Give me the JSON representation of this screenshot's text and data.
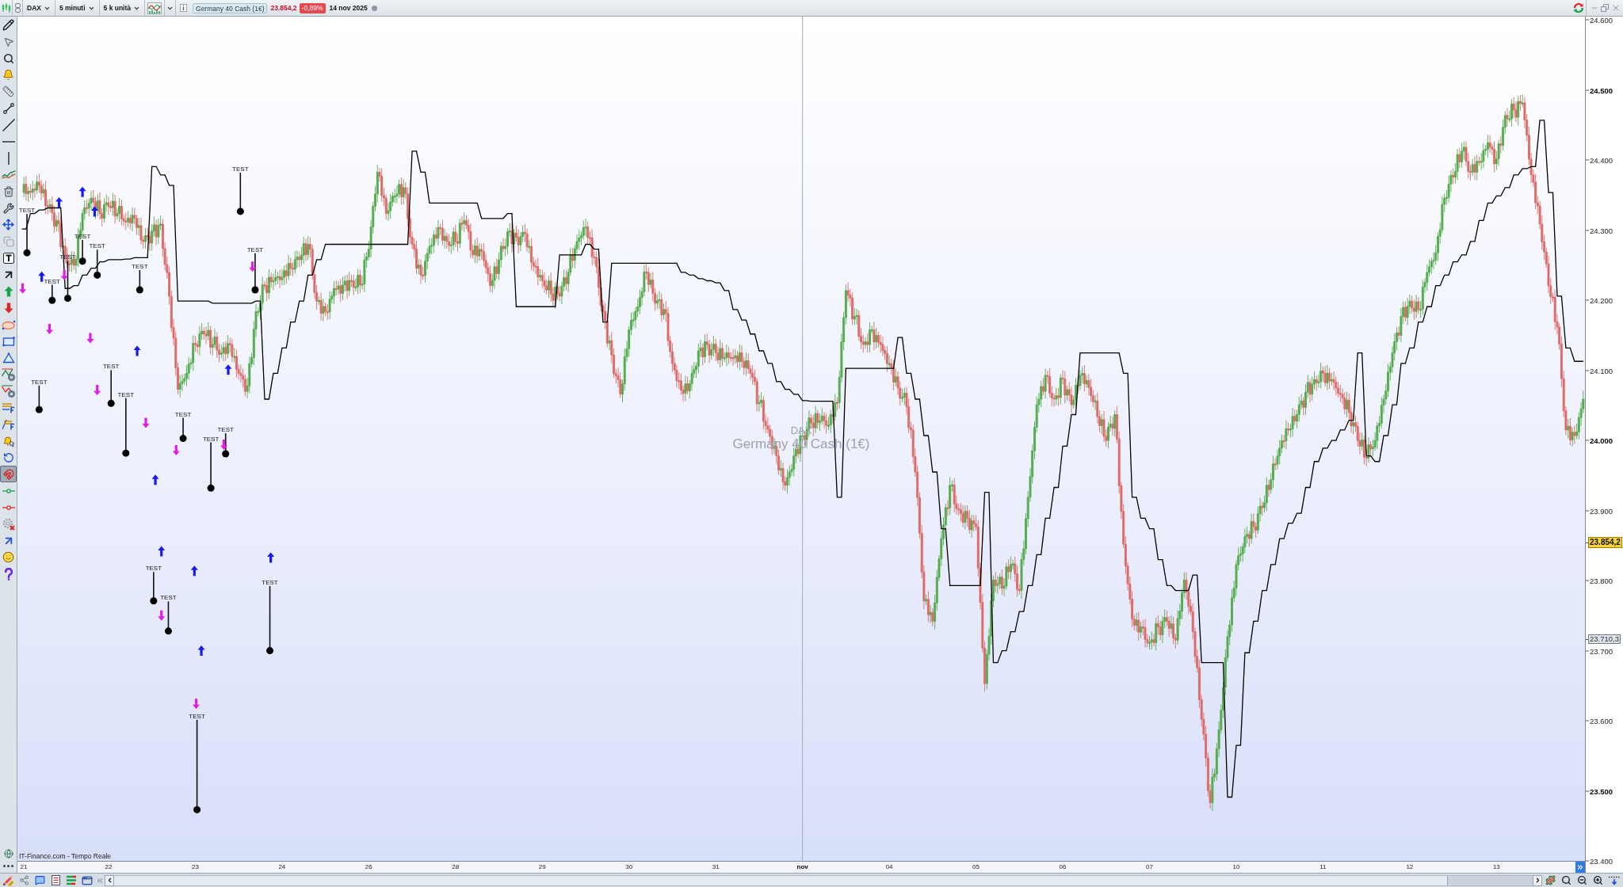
{
  "toolbar": {
    "symbol": "DAX",
    "timeframe": "5 minuti",
    "units": "5 k unità",
    "instrument": "Germany 40 Cash (1€)",
    "last_price": "23.854,2",
    "change": "-0,89%",
    "date": "14 nov 2025"
  },
  "left_toolbar": {
    "tools": [
      {
        "selected": false
      },
      {
        "selected": false
      },
      {
        "selected": false
      },
      {
        "selected": false
      },
      {
        "selected": false
      },
      {
        "selected": false
      },
      {
        "selected": false
      },
      {
        "selected": false
      },
      {
        "selected": false
      },
      {
        "selected": false
      },
      {
        "selected": false
      },
      {
        "selected": false
      },
      {
        "selected": false
      },
      {
        "selected": false
      },
      {
        "selected": false
      },
      {
        "selected": false
      },
      {
        "selected": false
      },
      {
        "selected": false
      },
      {
        "selected": false
      },
      {
        "selected": false
      },
      {
        "selected": false
      },
      {
        "selected": false
      },
      {
        "selected": false
      },
      {
        "selected": false
      },
      {
        "selected": false
      },
      {
        "selected": false
      },
      {
        "selected": false
      },
      {
        "selected": true
      },
      {
        "selected": false
      },
      {
        "selected": false
      },
      {
        "selected": false
      },
      {
        "selected": false
      },
      {
        "selected": false
      },
      {
        "selected": false
      }
    ]
  },
  "chart": {
    "watermark": {
      "symbol": "DAX",
      "name": "Germany 40 Cash (1€)"
    },
    "source": "IT-Finance.com - Tempo Reale",
    "price_tags": [
      {
        "kind": "last",
        "text": "23.854,2"
      },
      {
        "kind": "level",
        "text": "23.710,3"
      }
    ],
    "chart_data": {
      "type": "line",
      "ylim": [
        23400,
        24605
      ],
      "categories": [
        "21",
        null,
        null,
        null,
        null,
        null,
        null,
        null,
        null,
        null,
        null,
        null,
        null,
        null,
        null,
        null,
        null,
        null,
        null,
        null,
        "22",
        null,
        null,
        null,
        null,
        null,
        null,
        null,
        null,
        null,
        null,
        null,
        null,
        null,
        null,
        null,
        null,
        null,
        null,
        null,
        "23",
        null,
        null,
        null,
        null,
        null,
        null,
        null,
        null,
        null,
        null,
        null,
        null,
        null,
        null,
        null,
        null,
        null,
        null,
        null,
        "24",
        null,
        null,
        null,
        null,
        null,
        null,
        null,
        null,
        null,
        null,
        null,
        null,
        null,
        null,
        null,
        null,
        null,
        null,
        null,
        "26",
        null,
        null,
        null,
        null,
        null,
        null,
        null,
        null,
        null,
        null,
        null,
        null,
        null,
        null,
        null,
        null,
        null,
        null,
        null,
        "28",
        null,
        null,
        null,
        null,
        null,
        null,
        null,
        null,
        null,
        null,
        null,
        null,
        null,
        null,
        null,
        null,
        null,
        null,
        null,
        "29",
        null,
        null,
        null,
        null,
        null,
        null,
        null,
        null,
        null,
        null,
        null,
        null,
        null,
        null,
        null,
        null,
        null,
        null,
        null,
        "30",
        null,
        null,
        null,
        null,
        null,
        null,
        null,
        null,
        null,
        null,
        null,
        null,
        null,
        null,
        null,
        null,
        null,
        null,
        null,
        "31",
        null,
        null,
        null,
        null,
        null,
        null,
        null,
        null,
        null,
        null,
        null,
        null,
        null,
        null,
        null,
        null,
        null,
        null,
        null,
        "nov",
        null,
        null,
        null,
        null,
        null,
        null,
        null,
        null,
        null,
        null,
        null,
        null,
        null,
        null,
        null,
        null,
        null,
        null,
        null,
        "04",
        null,
        null,
        null,
        null,
        null,
        null,
        null,
        null,
        null,
        null,
        null,
        null,
        null,
        null,
        null,
        null,
        null,
        null,
        null,
        "05",
        null,
        null,
        null,
        null,
        null,
        null,
        null,
        null,
        null,
        null,
        null,
        null,
        null,
        null,
        null,
        null,
        null,
        null,
        null,
        "06",
        null,
        null,
        null,
        null,
        null,
        null,
        null,
        null,
        null,
        null,
        null,
        null,
        null,
        null,
        null,
        null,
        null,
        null,
        null,
        "07",
        null,
        null,
        null,
        null,
        null,
        null,
        null,
        null,
        null,
        null,
        null,
        null,
        null,
        null,
        null,
        null,
        null,
        null,
        null,
        "10",
        null,
        null,
        null,
        null,
        null,
        null,
        null,
        null,
        null,
        null,
        null,
        null,
        null,
        null,
        null,
        null,
        null,
        null,
        null,
        "11",
        null,
        null,
        null,
        null,
        null,
        null,
        null,
        null,
        null,
        null,
        null,
        null,
        null,
        null,
        null,
        null,
        null,
        null,
        null,
        "12",
        null,
        null,
        null,
        null,
        null,
        null,
        null,
        null,
        null,
        null,
        null,
        null,
        null,
        null,
        null,
        null,
        null,
        null,
        null,
        "13",
        null,
        null,
        null,
        null,
        null,
        null,
        null,
        null,
        null,
        null,
        null,
        null,
        null,
        null,
        null,
        null,
        null,
        null,
        null,
        null
      ],
      "yticks": [
        {
          "value": 24600,
          "label": "24.600"
        },
        {
          "value": 24500,
          "label": "24.500"
        },
        {
          "value": 24400,
          "label": "24.400"
        },
        {
          "value": 24300,
          "label": "24.300"
        },
        {
          "value": 24200,
          "label": "24.200"
        },
        {
          "value": 24100,
          "label": "24.100"
        },
        {
          "value": 24000,
          "label": "24.000"
        },
        {
          "value": 23900,
          "label": "23.900"
        },
        {
          "value": 23800,
          "label": "23.800"
        },
        {
          "value": 23700,
          "label": "23.700"
        },
        {
          "value": 23600,
          "label": "23.600"
        },
        {
          "value": 23500,
          "label": "23.500"
        },
        {
          "value": 23400,
          "label": "23.400"
        }
      ],
      "series": [
        {
          "color": "#000000",
          "values": [
            24302,
            24302,
            24324,
            24324,
            24329,
            24329,
            24332,
            24332,
            24332,
            24332,
            24217,
            24217,
            24221,
            24221,
            24236,
            24236,
            24246,
            24246,
            24255,
            24255,
            24258,
            24258,
            24258,
            24258,
            24259,
            24259,
            24261,
            24261,
            24261,
            24261,
            24391,
            24391,
            24379,
            24379,
            24364,
            24364,
            24199,
            24199,
            24199,
            24199,
            24199,
            24199,
            24199,
            24199,
            24196,
            24196,
            24196,
            24196,
            24196,
            24196,
            24196,
            24196,
            24196,
            24196,
            24199,
            24199,
            24059,
            24059,
            24096,
            24096,
            24132,
            24132,
            24169,
            24169,
            24199,
            24199,
            24236,
            24236,
            24258,
            24258,
            24280,
            24280,
            24280,
            24280,
            24280,
            24280,
            24280,
            24280,
            24280,
            24280,
            24280,
            24280,
            24280,
            24280,
            24280,
            24280,
            24280,
            24280,
            24280,
            24280,
            24413,
            24413,
            24383,
            24383,
            24339,
            24339,
            24339,
            24339,
            24339,
            24339,
            24339,
            24339,
            24339,
            24339,
            24339,
            24339,
            24317,
            24317,
            24317,
            24317,
            24317,
            24317,
            24324,
            24324,
            24191,
            24191,
            24191,
            24191,
            24191,
            24191,
            24191,
            24191,
            24191,
            24191,
            24265,
            24265,
            24265,
            24265,
            24265,
            24265,
            24280,
            24280,
            24273,
            24273,
            24169,
            24169,
            24253,
            24253,
            24253,
            24253,
            24253,
            24253,
            24253,
            24253,
            24253,
            24253,
            24253,
            24253,
            24253,
            24253,
            24253,
            24253,
            24240,
            24240,
            24236,
            24236,
            24231,
            24231,
            24228,
            24228,
            24225,
            24225,
            24214,
            24214,
            24187,
            24187,
            24172,
            24172,
            24152,
            24152,
            24128,
            24128,
            24110,
            24110,
            24084,
            24084,
            24073,
            24073,
            24066,
            24066,
            24057,
            24057,
            24056,
            24056,
            24056,
            24056,
            24056,
            24056,
            23919,
            23919,
            24103,
            24103,
            24103,
            24103,
            24103,
            24103,
            24103,
            24103,
            24103,
            24103,
            24103,
            24103,
            24147,
            24147,
            24096,
            24096,
            24059,
            24059,
            24007,
            24007,
            23955,
            23955,
            23874,
            23874,
            23793,
            23793,
            23793,
            23793,
            23793,
            23793,
            23793,
            23793,
            23926,
            23926,
            23683,
            23683,
            23700,
            23700,
            23727,
            23727,
            23756,
            23756,
            23793,
            23793,
            23837,
            23837,
            23889,
            23889,
            23933,
            23933,
            23992,
            23992,
            24037,
            24037,
            24125,
            24125,
            24125,
            24125,
            24125,
            24125,
            24125,
            24125,
            24125,
            24125,
            24096,
            24096,
            23919,
            23919,
            23889,
            23889,
            23874,
            23874,
            23830,
            23830,
            23793,
            23793,
            23786,
            23786,
            23786,
            23786,
            23808,
            23808,
            23683,
            23683,
            23683,
            23683,
            23683,
            23683,
            23491,
            23491,
            23565,
            23565,
            23697,
            23697,
            23742,
            23742,
            23786,
            23786,
            23823,
            23823,
            23860,
            23860,
            23882,
            23882,
            23896,
            23896,
            23933,
            23933,
            23970,
            23970,
            23989,
            23989,
            24000,
            24000,
            24015,
            24015,
            24029,
            24029,
            24125,
            24125,
            23978,
            23978,
            23970,
            23970,
            24007,
            24007,
            24051,
            24051,
            24110,
            24110,
            24132,
            24132,
            24169,
            24169,
            24191,
            24191,
            24221,
            24221,
            24236,
            24236,
            24255,
            24255,
            24265,
            24265,
            24284,
            24284,
            24314,
            24314,
            24339,
            24339,
            24349,
            24349,
            24361,
            24361,
            24379,
            24379,
            24388,
            24388,
            24391,
            24391,
            24457,
            24457,
            24354,
            24354,
            24206,
            24206,
            24132,
            24132,
            24113,
            24113,
            24113
          ]
        }
      ],
      "annotations": [
        "TEST",
        "TEST",
        "TEST",
        "TEST",
        "TEST",
        "TEST",
        "TEST",
        "TEST",
        "TEST",
        "TEST",
        "TEST",
        "TEST",
        "TEST",
        "TEST",
        "TEST",
        "TEST",
        "TEST",
        "TEST"
      ]
    }
  }
}
